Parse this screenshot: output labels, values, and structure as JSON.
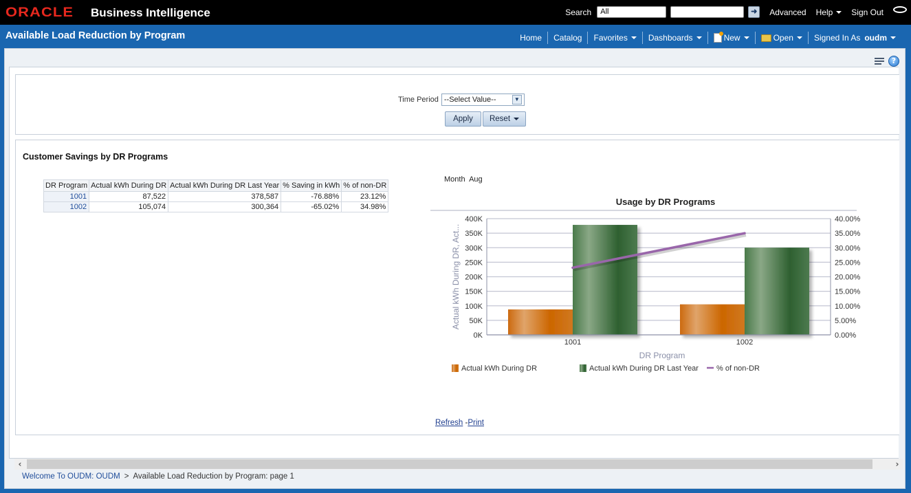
{
  "header": {
    "logo": "ORACLE",
    "product": "Business Intelligence",
    "search_label": "Search",
    "search_scope": "All",
    "search_value": "",
    "links": {
      "advanced": "Advanced",
      "help": "Help",
      "sign_out": "Sign Out"
    }
  },
  "titlebar": {
    "page_title": "Available Load Reduction by Program",
    "nav": {
      "home": "Home",
      "catalog": "Catalog",
      "favorites": "Favorites",
      "dashboards": "Dashboards",
      "new": "New",
      "open": "Open",
      "signed_in_as": "Signed In As",
      "user": "oudm"
    }
  },
  "prompt": {
    "label": "Time Period",
    "selected": "--Select Value--",
    "apply": "Apply",
    "reset": "Reset"
  },
  "report": {
    "title": "Customer Savings by DR Programs",
    "table": {
      "columns": [
        "DR Program",
        "Actual kWh During DR",
        "Actual kWh During DR Last Year",
        "% Saving in kWh",
        "% of non-DR"
      ],
      "rows": [
        [
          "1001",
          "87,522",
          "378,587",
          "-76.88%",
          "23.12%"
        ],
        [
          "1002",
          "105,074",
          "300,364",
          "-65.02%",
          "34.98%"
        ]
      ]
    },
    "month_label": "Month",
    "month_value": "Aug",
    "links": {
      "refresh": "Refresh",
      "separator": "-",
      "print": "Print"
    }
  },
  "chart_data": {
    "type": "bar",
    "title": "Usage by DR Programs",
    "xlabel": "DR Program",
    "ylabel": "Actual kWh During DR, Act...",
    "y2label": "% of non-DR",
    "categories": [
      "1001",
      "1002"
    ],
    "ylim": [
      0,
      400000
    ],
    "yticks": [
      "0K",
      "50K",
      "100K",
      "150K",
      "200K",
      "250K",
      "300K",
      "350K",
      "400K"
    ],
    "y2lim": [
      0,
      40
    ],
    "y2ticks": [
      "0.00%",
      "5.00%",
      "10.00%",
      "15.00%",
      "20.00%",
      "25.00%",
      "30.00%",
      "35.00%",
      "40.00%"
    ],
    "grid": true,
    "legend_position": "bottom",
    "series": [
      {
        "name": "Actual kWh During DR",
        "type": "bar",
        "axis": "left",
        "values": [
          87522,
          105074
        ],
        "color": "#cc6600"
      },
      {
        "name": "Actual kWh During DR Last Year",
        "type": "bar",
        "axis": "left",
        "values": [
          378587,
          300364
        ],
        "color": "#336633"
      },
      {
        "name": "% of non-DR",
        "type": "line",
        "axis": "right",
        "values": [
          23.12,
          34.98
        ],
        "color": "#9966aa"
      }
    ]
  },
  "footer": {
    "breadcrumb_root": "Welcome To OUDM: OUDM",
    "separator": ">",
    "breadcrumb_current": "Available Load Reduction by Program: page 1"
  }
}
